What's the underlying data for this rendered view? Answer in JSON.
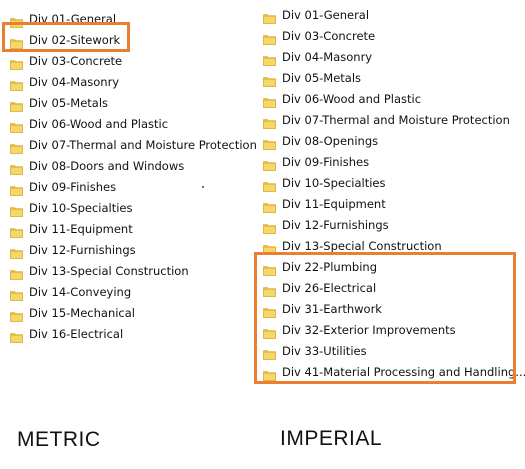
{
  "colors": {
    "folder_body": "#f6d76a",
    "folder_tab": "#e9bf3f",
    "folder_edge": "#d6a628",
    "highlight": "#ed7d31"
  },
  "metric": {
    "caption": "METRIC",
    "items": [
      "Div 01-General",
      "Div 02-Sitework",
      "Div 03-Concrete",
      "Div 04-Masonry",
      "Div 05-Metals",
      "Div 06-Wood and Plastic",
      "Div 07-Thermal and Moisture Protection",
      "Div 08-Doors and Windows",
      "Div 09-Finishes",
      "Div 10-Specialties",
      "Div 11-Equipment",
      "Div 12-Furnishings",
      "Div 13-Special Construction",
      "Div 14-Conveying",
      "Div 15-Mechanical",
      "Div 16-Electrical"
    ],
    "highlighted": [
      "Div 02-Sitework"
    ]
  },
  "imperial": {
    "caption": "IMPERIAL",
    "items": [
      "Div 01-General",
      "Div 03-Concrete",
      "Div 04-Masonry",
      "Div 05-Metals",
      "Div 06-Wood and Plastic",
      "Div 07-Thermal and Moisture Protection",
      "Div 08-Openings",
      "Div 09-Finishes",
      "Div 10-Specialties",
      "Div 11-Equipment",
      "Div 12-Furnishings",
      "Div 13-Special Construction",
      "Div 22-Plumbing",
      "Div 26-Electrical",
      "Div 31-Earthwork",
      "Div 32-Exterior Improvements",
      "Div 33-Utilities",
      "Div 41-Material Processing and Handling..."
    ],
    "highlighted": [
      "Div 22-Plumbing",
      "Div 26-Electrical",
      "Div 31-Earthwork",
      "Div 32-Exterior Improvements",
      "Div 33-Utilities",
      "Div 41-Material Processing and Handling..."
    ]
  },
  "icons": {
    "folder": "folder-icon"
  }
}
